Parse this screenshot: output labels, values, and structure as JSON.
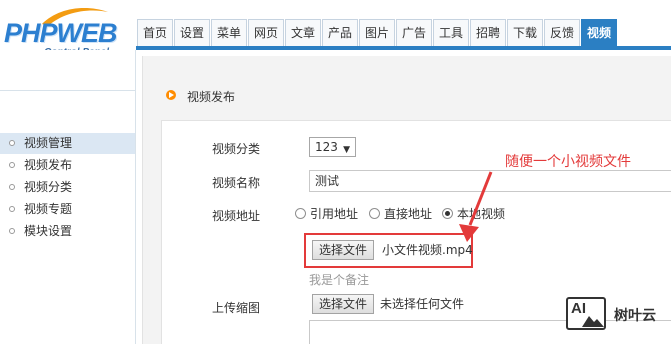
{
  "brand": {
    "logo_text": "PHPWEB",
    "logo_subtitle": "Control Panel"
  },
  "nav": {
    "tabs": [
      {
        "label": "首页"
      },
      {
        "label": "设置"
      },
      {
        "label": "菜单"
      },
      {
        "label": "网页"
      },
      {
        "label": "文章"
      },
      {
        "label": "产品"
      },
      {
        "label": "图片"
      },
      {
        "label": "广告"
      },
      {
        "label": "工具"
      },
      {
        "label": "招聘"
      },
      {
        "label": "下载"
      },
      {
        "label": "反馈"
      },
      {
        "label": "视频",
        "active": true
      }
    ],
    "accent_color": "#2b7fc3"
  },
  "sidebar": {
    "items": [
      {
        "label": "视频管理",
        "active": true
      },
      {
        "label": "视频发布"
      },
      {
        "label": "视频分类"
      },
      {
        "label": "视频专题"
      },
      {
        "label": "模块设置"
      }
    ]
  },
  "main": {
    "section_title": "视频发布",
    "form": {
      "category_label": "视频分类",
      "category_value": "123",
      "name_label": "视频名称",
      "name_value": "测试",
      "address_label": "视频地址",
      "address_options": [
        {
          "label": "引用地址",
          "checked": false
        },
        {
          "label": "直接地址",
          "checked": false
        },
        {
          "label": "本地视频",
          "checked": true
        }
      ],
      "video_file_button": "选择文件",
      "video_file_name": "小文件视频.mp4",
      "hint": "我是个备注",
      "thumb_label": "上传缩图",
      "thumb_file_button": "选择文件",
      "thumb_file_name": "未选择任何文件"
    }
  },
  "annotation": {
    "text": "随便一个小视频文件",
    "color": "#e33a3a"
  },
  "watermark": {
    "badge": "AI",
    "name": "树叶云"
  }
}
